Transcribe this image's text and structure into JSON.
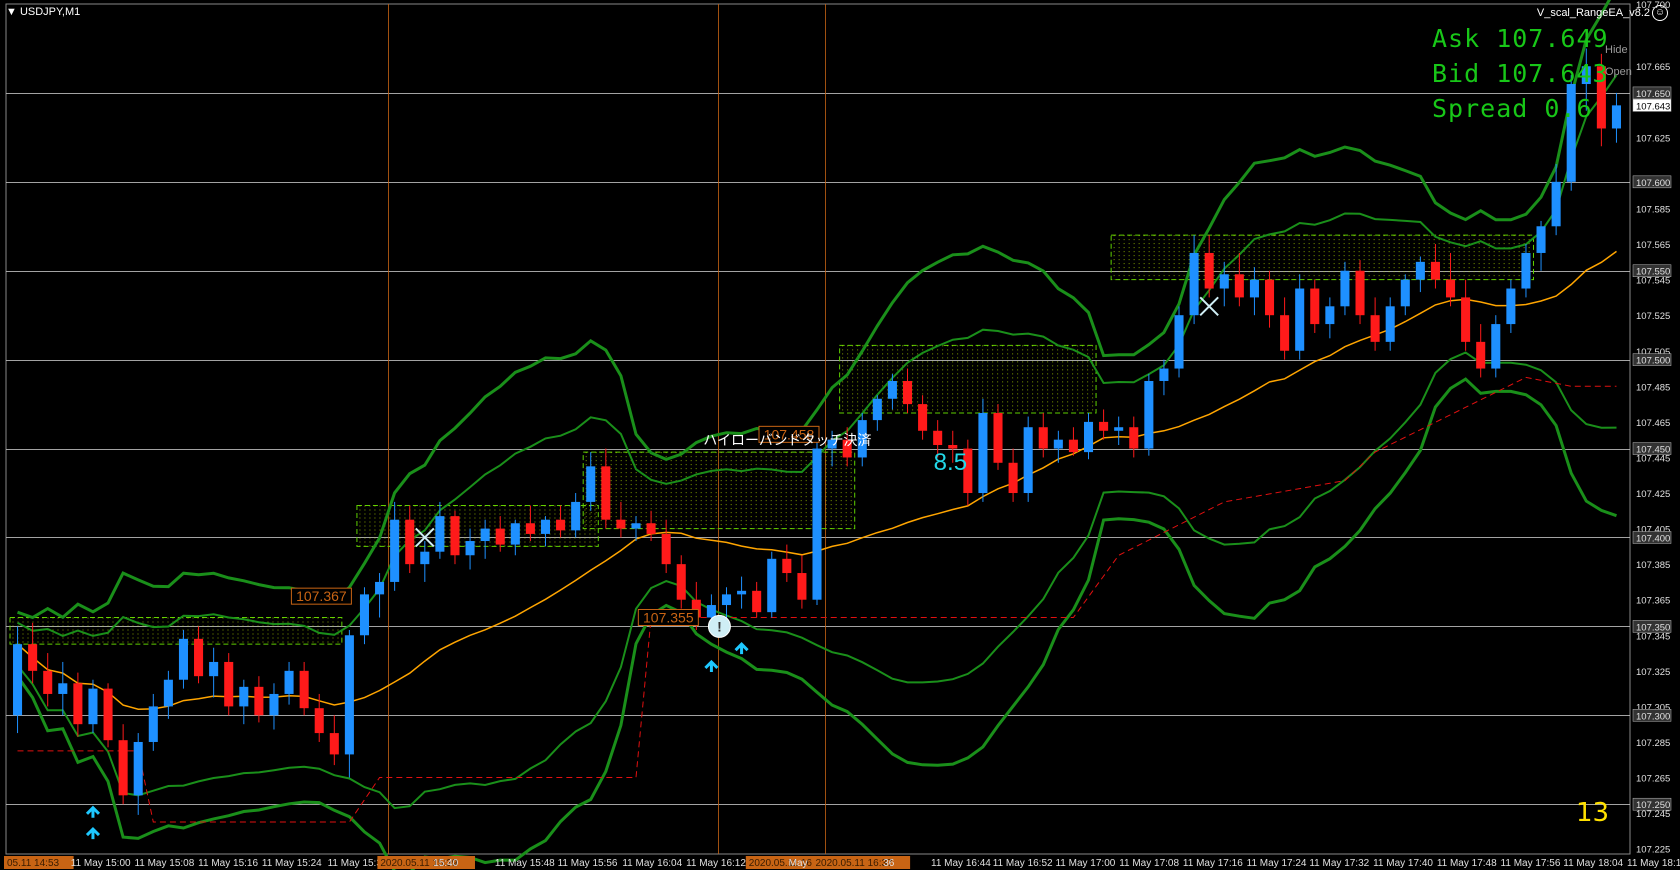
{
  "window": {
    "symbol_title": "USDJPY,M1",
    "ea_name": "V_scal_RangeEA_v8.2",
    "ea_icon": "☺"
  },
  "quotes": {
    "ask": "Ask 107.649",
    "bid": "Bid 107.643",
    "spread": "Spread 0.6",
    "hide_label": "Hide",
    "open_label": "Open"
  },
  "colors": {
    "background": "#000000",
    "bull": "#1e90ff",
    "bear": "#ff1a1a",
    "bollinger": "#1a8f1a",
    "moving_average": "#ffa500",
    "grid": "#c0c0c0",
    "quote_text": "#18c718",
    "counter": "#ffe000",
    "range_box": "#b5e000",
    "range_label": "#c86414",
    "arrow": "#1ec8ff"
  },
  "annotations": {
    "jp_note": "ハイローバンドタッチ決済",
    "signal_value": "8.5",
    "counter": "13",
    "ea_marker": "!"
  },
  "chart_data": {
    "type": "candlestick",
    "title": "USDJPY,M1",
    "y_ticks": [
      "107.700",
      "107.665",
      "107.650",
      "107.643",
      "107.625",
      "107.600",
      "107.585",
      "107.565",
      "107.550",
      "107.545",
      "107.525",
      "107.505",
      "107.500",
      "107.485",
      "107.465",
      "107.450",
      "107.445",
      "107.425",
      "107.405",
      "107.400",
      "107.385",
      "107.365",
      "107.350",
      "107.345",
      "107.325",
      "107.305",
      "107.300",
      "107.285",
      "107.265",
      "107.250",
      "107.245",
      "107.225"
    ],
    "highlighted_y_labels": [
      "107.650",
      "107.643",
      "107.600",
      "107.550",
      "107.500",
      "107.450",
      "107.400",
      "107.350",
      "107.300",
      "107.250"
    ],
    "ylim": [
      107.222,
      107.7
    ],
    "x_ticks": [
      "05.11 14:53",
      "11 May 15:00",
      "11 May 15:08",
      "11 May 15:16",
      "11 May 15:24",
      "11 May 15:32",
      "2020.05.11 15:39",
      "15:40",
      "11 May 15:48",
      "11 May 15:56",
      "11 May 16:04",
      "11 May 16:12",
      "2020.05.11 16:24",
      "May",
      "2020.05.11 16:37",
      "36",
      "11 May 16:44",
      "11 May 16:52",
      "11 May 17:00",
      "11 May 17:08",
      "11 May 17:16",
      "11 May 17:24",
      "11 May 17:32",
      "11 May 17:40",
      "11 May 17:48",
      "11 May 17:56",
      "11 May 18:04",
      "11 May 18:12"
    ],
    "range_labels": [
      {
        "text": "107.367",
        "price": 107.367
      },
      {
        "text": "107.458",
        "price": 107.458
      },
      {
        "text": "107.355",
        "price": 107.355
      }
    ],
    "range_boxes": [
      {
        "low": 107.34,
        "high": 107.355,
        "start": 0,
        "end": 21
      },
      {
        "low": 107.395,
        "high": 107.418,
        "start": 23,
        "end": 38
      },
      {
        "low": 107.405,
        "high": 107.448,
        "start": 38,
        "end": 55
      },
      {
        "low": 107.47,
        "high": 107.508,
        "start": 55,
        "end": 71
      },
      {
        "low": 107.545,
        "high": 107.57,
        "start": 73,
        "end": 100
      }
    ],
    "candles": [
      {
        "o": 107.3,
        "h": 107.35,
        "l": 107.29,
        "c": 107.34
      },
      {
        "o": 107.34,
        "h": 107.352,
        "l": 107.318,
        "c": 107.325
      },
      {
        "o": 107.325,
        "h": 107.335,
        "l": 107.305,
        "c": 107.312
      },
      {
        "o": 107.312,
        "h": 107.33,
        "l": 107.3,
        "c": 107.318
      },
      {
        "o": 107.318,
        "h": 107.324,
        "l": 107.288,
        "c": 107.295
      },
      {
        "o": 107.295,
        "h": 107.32,
        "l": 107.29,
        "c": 107.315
      },
      {
        "o": 107.315,
        "h": 107.318,
        "l": 107.282,
        "c": 107.286
      },
      {
        "o": 107.286,
        "h": 107.295,
        "l": 107.25,
        "c": 107.255
      },
      {
        "o": 107.255,
        "h": 107.29,
        "l": 107.244,
        "c": 107.285
      },
      {
        "o": 107.285,
        "h": 107.312,
        "l": 107.28,
        "c": 107.305
      },
      {
        "o": 107.305,
        "h": 107.325,
        "l": 107.298,
        "c": 107.32
      },
      {
        "o": 107.32,
        "h": 107.348,
        "l": 107.315,
        "c": 107.343
      },
      {
        "o": 107.343,
        "h": 107.35,
        "l": 107.318,
        "c": 107.322
      },
      {
        "o": 107.322,
        "h": 107.338,
        "l": 107.31,
        "c": 107.33
      },
      {
        "o": 107.33,
        "h": 107.335,
        "l": 107.3,
        "c": 107.305
      },
      {
        "o": 107.305,
        "h": 107.32,
        "l": 107.295,
        "c": 107.316
      },
      {
        "o": 107.316,
        "h": 107.322,
        "l": 107.296,
        "c": 107.3
      },
      {
        "o": 107.3,
        "h": 107.318,
        "l": 107.292,
        "c": 107.312
      },
      {
        "o": 107.312,
        "h": 107.33,
        "l": 107.306,
        "c": 107.325
      },
      {
        "o": 107.325,
        "h": 107.33,
        "l": 107.3,
        "c": 107.304
      },
      {
        "o": 107.304,
        "h": 107.312,
        "l": 107.285,
        "c": 107.29
      },
      {
        "o": 107.29,
        "h": 107.3,
        "l": 107.272,
        "c": 107.278
      },
      {
        "o": 107.278,
        "h": 107.348,
        "l": 107.265,
        "c": 107.345
      },
      {
        "o": 107.345,
        "h": 107.372,
        "l": 107.34,
        "c": 107.368
      },
      {
        "o": 107.368,
        "h": 107.38,
        "l": 107.355,
        "c": 107.375
      },
      {
        "o": 107.375,
        "h": 107.42,
        "l": 107.37,
        "c": 107.41
      },
      {
        "o": 107.41,
        "h": 107.418,
        "l": 107.38,
        "c": 107.385
      },
      {
        "o": 107.385,
        "h": 107.398,
        "l": 107.375,
        "c": 107.392
      },
      {
        "o": 107.392,
        "h": 107.42,
        "l": 107.388,
        "c": 107.412
      },
      {
        "o": 107.412,
        "h": 107.415,
        "l": 107.385,
        "c": 107.39
      },
      {
        "o": 107.39,
        "h": 107.405,
        "l": 107.382,
        "c": 107.398
      },
      {
        "o": 107.398,
        "h": 107.41,
        "l": 107.388,
        "c": 107.405
      },
      {
        "o": 107.405,
        "h": 107.412,
        "l": 107.392,
        "c": 107.396
      },
      {
        "o": 107.396,
        "h": 107.41,
        "l": 107.39,
        "c": 107.408
      },
      {
        "o": 107.408,
        "h": 107.418,
        "l": 107.398,
        "c": 107.402
      },
      {
        "o": 107.402,
        "h": 107.412,
        "l": 107.395,
        "c": 107.41
      },
      {
        "o": 107.41,
        "h": 107.418,
        "l": 107.4,
        "c": 107.404
      },
      {
        "o": 107.404,
        "h": 107.425,
        "l": 107.4,
        "c": 107.42
      },
      {
        "o": 107.42,
        "h": 107.448,
        "l": 107.415,
        "c": 107.44
      },
      {
        "o": 107.44,
        "h": 107.45,
        "l": 107.405,
        "c": 107.41
      },
      {
        "o": 107.41,
        "h": 107.42,
        "l": 107.4,
        "c": 107.405
      },
      {
        "o": 107.405,
        "h": 107.412,
        "l": 107.398,
        "c": 107.408
      },
      {
        "o": 107.408,
        "h": 107.415,
        "l": 107.398,
        "c": 107.402
      },
      {
        "o": 107.402,
        "h": 107.41,
        "l": 107.38,
        "c": 107.385
      },
      {
        "o": 107.385,
        "h": 107.39,
        "l": 107.36,
        "c": 107.365
      },
      {
        "o": 107.365,
        "h": 107.375,
        "l": 107.348,
        "c": 107.355
      },
      {
        "o": 107.355,
        "h": 107.368,
        "l": 107.35,
        "c": 107.362
      },
      {
        "o": 107.362,
        "h": 107.372,
        "l": 107.355,
        "c": 107.368
      },
      {
        "o": 107.368,
        "h": 107.378,
        "l": 107.36,
        "c": 107.37
      },
      {
        "o": 107.37,
        "h": 107.375,
        "l": 107.355,
        "c": 107.358
      },
      {
        "o": 107.358,
        "h": 107.392,
        "l": 107.355,
        "c": 107.388
      },
      {
        "o": 107.388,
        "h": 107.396,
        "l": 107.375,
        "c": 107.38
      },
      {
        "o": 107.38,
        "h": 107.39,
        "l": 107.36,
        "c": 107.365
      },
      {
        "o": 107.365,
        "h": 107.458,
        "l": 107.362,
        "c": 107.45
      },
      {
        "o": 107.45,
        "h": 107.46,
        "l": 107.44,
        "c": 107.455
      },
      {
        "o": 107.455,
        "h": 107.462,
        "l": 107.44,
        "c": 107.445
      },
      {
        "o": 107.445,
        "h": 107.47,
        "l": 107.44,
        "c": 107.466
      },
      {
        "o": 107.466,
        "h": 107.48,
        "l": 107.46,
        "c": 107.478
      },
      {
        "o": 107.478,
        "h": 107.492,
        "l": 107.472,
        "c": 107.488
      },
      {
        "o": 107.488,
        "h": 107.495,
        "l": 107.47,
        "c": 107.475
      },
      {
        "o": 107.475,
        "h": 107.48,
        "l": 107.455,
        "c": 107.46
      },
      {
        "o": 107.46,
        "h": 107.466,
        "l": 107.445,
        "c": 107.452
      },
      {
        "o": 107.452,
        "h": 107.46,
        "l": 107.442,
        "c": 107.45
      },
      {
        "o": 107.45,
        "h": 107.455,
        "l": 107.418,
        "c": 107.425
      },
      {
        "o": 107.425,
        "h": 107.478,
        "l": 107.42,
        "c": 107.47
      },
      {
        "o": 107.47,
        "h": 107.475,
        "l": 107.438,
        "c": 107.442
      },
      {
        "o": 107.442,
        "h": 107.45,
        "l": 107.42,
        "c": 107.425
      },
      {
        "o": 107.425,
        "h": 107.468,
        "l": 107.42,
        "c": 107.462
      },
      {
        "o": 107.462,
        "h": 107.47,
        "l": 107.445,
        "c": 107.45
      },
      {
        "o": 107.45,
        "h": 107.46,
        "l": 107.442,
        "c": 107.455
      },
      {
        "o": 107.455,
        "h": 107.462,
        "l": 107.446,
        "c": 107.448
      },
      {
        "o": 107.448,
        "h": 107.47,
        "l": 107.444,
        "c": 107.465
      },
      {
        "o": 107.465,
        "h": 107.472,
        "l": 107.455,
        "c": 107.46
      },
      {
        "o": 107.46,
        "h": 107.468,
        "l": 107.452,
        "c": 107.462
      },
      {
        "o": 107.462,
        "h": 107.468,
        "l": 107.445,
        "c": 107.45
      },
      {
        "o": 107.45,
        "h": 107.492,
        "l": 107.446,
        "c": 107.488
      },
      {
        "o": 107.488,
        "h": 107.5,
        "l": 107.48,
        "c": 107.495
      },
      {
        "o": 107.495,
        "h": 107.53,
        "l": 107.49,
        "c": 107.525
      },
      {
        "o": 107.525,
        "h": 107.57,
        "l": 107.52,
        "c": 107.56
      },
      {
        "o": 107.56,
        "h": 107.57,
        "l": 107.535,
        "c": 107.54
      },
      {
        "o": 107.54,
        "h": 107.555,
        "l": 107.53,
        "c": 107.548
      },
      {
        "o": 107.548,
        "h": 107.56,
        "l": 107.53,
        "c": 107.535
      },
      {
        "o": 107.535,
        "h": 107.552,
        "l": 107.525,
        "c": 107.545
      },
      {
        "o": 107.545,
        "h": 107.55,
        "l": 107.518,
        "c": 107.525
      },
      {
        "o": 107.525,
        "h": 107.535,
        "l": 107.5,
        "c": 107.505
      },
      {
        "o": 107.505,
        "h": 107.548,
        "l": 107.5,
        "c": 107.54
      },
      {
        "o": 107.54,
        "h": 107.545,
        "l": 107.515,
        "c": 107.52
      },
      {
        "o": 107.52,
        "h": 107.535,
        "l": 107.512,
        "c": 107.53
      },
      {
        "o": 107.53,
        "h": 107.555,
        "l": 107.525,
        "c": 107.55
      },
      {
        "o": 107.55,
        "h": 107.556,
        "l": 107.52,
        "c": 107.525
      },
      {
        "o": 107.525,
        "h": 107.535,
        "l": 107.505,
        "c": 107.51
      },
      {
        "o": 107.51,
        "h": 107.535,
        "l": 107.505,
        "c": 107.53
      },
      {
        "o": 107.53,
        "h": 107.548,
        "l": 107.525,
        "c": 107.545
      },
      {
        "o": 107.545,
        "h": 107.558,
        "l": 107.538,
        "c": 107.555
      },
      {
        "o": 107.555,
        "h": 107.565,
        "l": 107.54,
        "c": 107.545
      },
      {
        "o": 107.545,
        "h": 107.56,
        "l": 107.53,
        "c": 107.535
      },
      {
        "o": 107.535,
        "h": 107.545,
        "l": 107.505,
        "c": 107.51
      },
      {
        "o": 107.51,
        "h": 107.52,
        "l": 107.49,
        "c": 107.495
      },
      {
        "o": 107.495,
        "h": 107.525,
        "l": 107.49,
        "c": 107.52
      },
      {
        "o": 107.52,
        "h": 107.545,
        "l": 107.515,
        "c": 107.54
      },
      {
        "o": 107.54,
        "h": 107.565,
        "l": 107.535,
        "c": 107.56
      },
      {
        "o": 107.56,
        "h": 107.578,
        "l": 107.55,
        "c": 107.575
      },
      {
        "o": 107.575,
        "h": 107.61,
        "l": 107.57,
        "c": 107.6
      },
      {
        "o": 107.6,
        "h": 107.66,
        "l": 107.595,
        "c": 107.655
      },
      {
        "o": 107.655,
        "h": 107.675,
        "l": 107.64,
        "c": 107.665
      },
      {
        "o": 107.665,
        "h": 107.672,
        "l": 107.62,
        "c": 107.63
      },
      {
        "o": 107.63,
        "h": 107.65,
        "l": 107.622,
        "c": 107.643
      }
    ]
  }
}
